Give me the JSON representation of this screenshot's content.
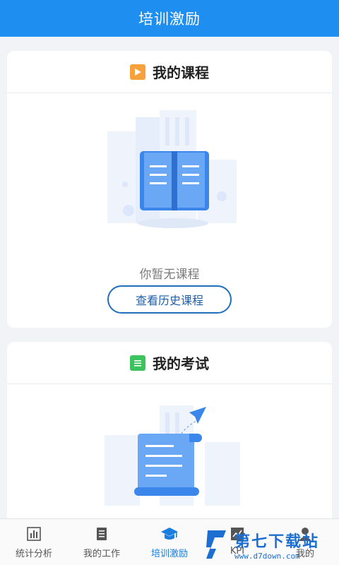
{
  "header": {
    "title": "培训激励"
  },
  "courses": {
    "title": "我的课程",
    "icon": "play-icon",
    "empty_text": "你暂无课程",
    "history_button": "查看历史课程"
  },
  "exams": {
    "title": "我的考试",
    "icon": "list-icon"
  },
  "tabbar": {
    "items": [
      {
        "label": "统计分析",
        "icon": "bar-chart-icon"
      },
      {
        "label": "我的工作",
        "icon": "document-icon"
      },
      {
        "label": "培训激励",
        "icon": "graduation-cap-icon",
        "active": true
      },
      {
        "label": "KPI",
        "icon": "line-chart-icon"
      },
      {
        "label": "我的",
        "icon": "person-icon"
      }
    ]
  },
  "watermark": {
    "title": "第七下载站",
    "url": "www.d7down.com"
  },
  "colors": {
    "primary": "#1e8ff0",
    "active_tab": "#1a7de0",
    "button_border": "#1f6fbd"
  }
}
